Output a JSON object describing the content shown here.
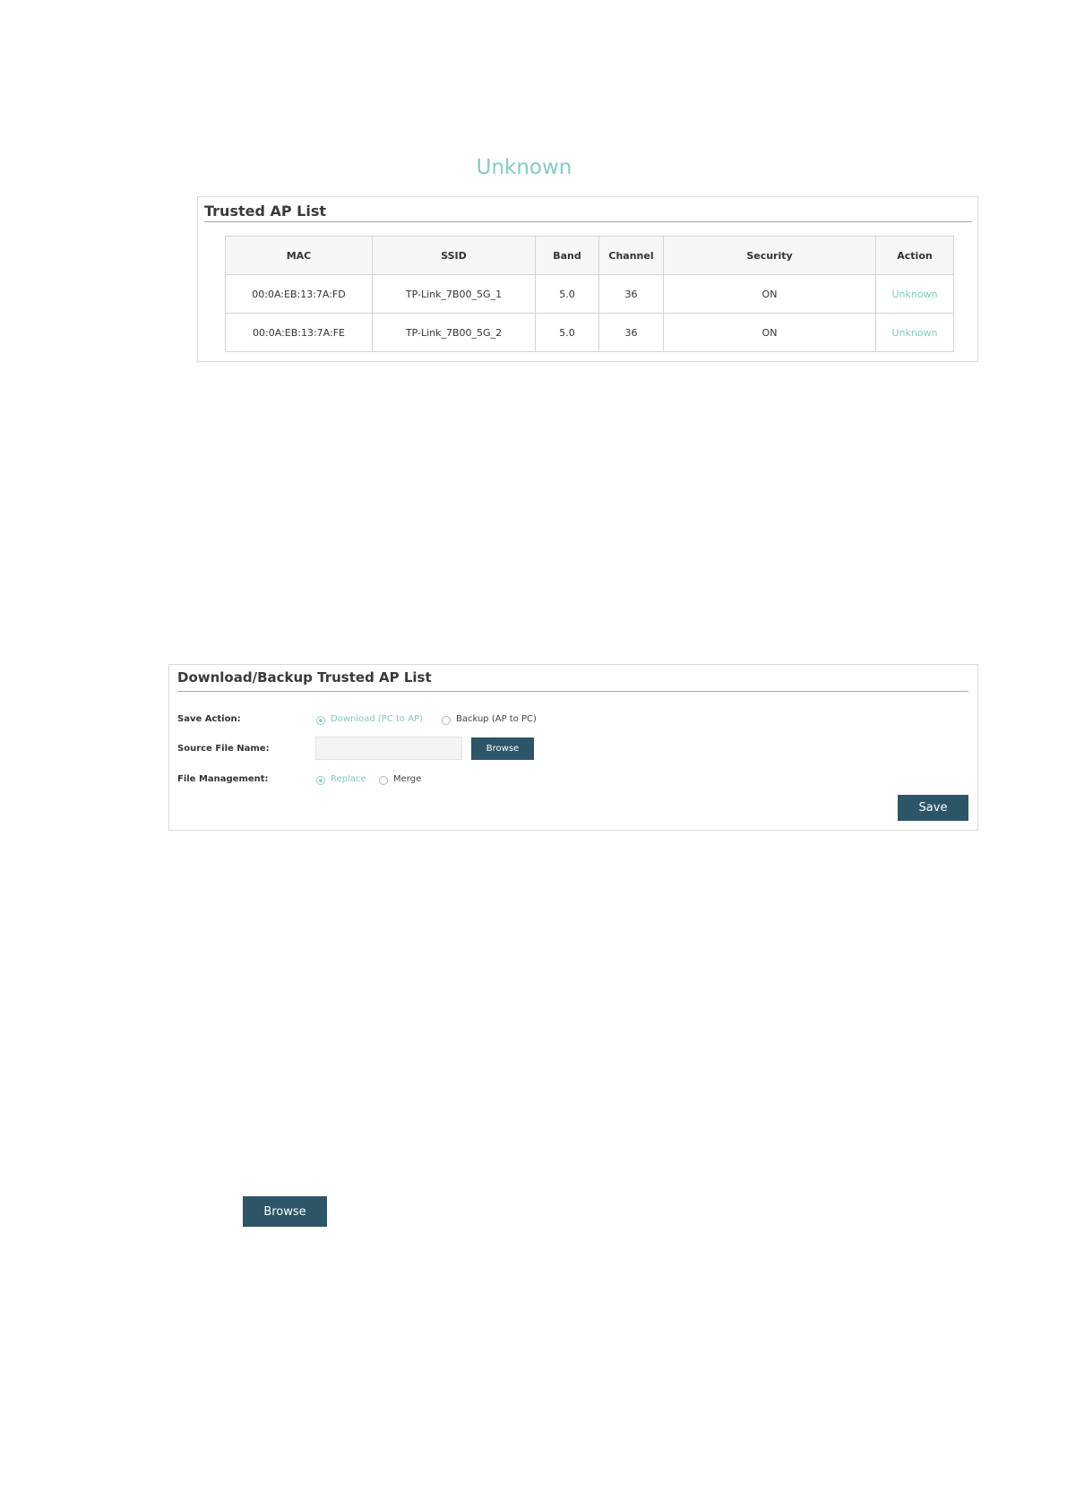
{
  "top_label": "Unknown",
  "trusted_ap": {
    "title": "Trusted AP List",
    "columns": [
      "MAC",
      "SSID",
      "Band",
      "Channel",
      "Security",
      "Action"
    ],
    "rows": [
      {
        "mac": "00:0A:EB:13:7A:FD",
        "ssid": "TP-Link_7B00_5G_1",
        "band": "5.0",
        "channel": "36",
        "security": "ON",
        "action": "Unknown"
      },
      {
        "mac": "00:0A:EB:13:7A:FE",
        "ssid": "TP-Link_7B00_5G_2",
        "band": "5.0",
        "channel": "36",
        "security": "ON",
        "action": "Unknown"
      }
    ]
  },
  "backup": {
    "title": "Download/Backup Trusted AP List",
    "save_action_label": "Save Action:",
    "save_action_options": [
      "Download (PC to AP)",
      "Backup (AP to PC)"
    ],
    "save_action_selected": "Download (PC to AP)",
    "source_file_label": "Source File Name:",
    "source_file_value": "",
    "browse_label": "Browse",
    "file_management_label": "File Management:",
    "file_management_options": [
      "Replace",
      "Merge"
    ],
    "file_management_selected": "Replace",
    "save_label": "Save"
  },
  "standalone_browse_label": "Browse",
  "colors": {
    "accent": "#7ec8c2",
    "button": "#2c5668"
  }
}
